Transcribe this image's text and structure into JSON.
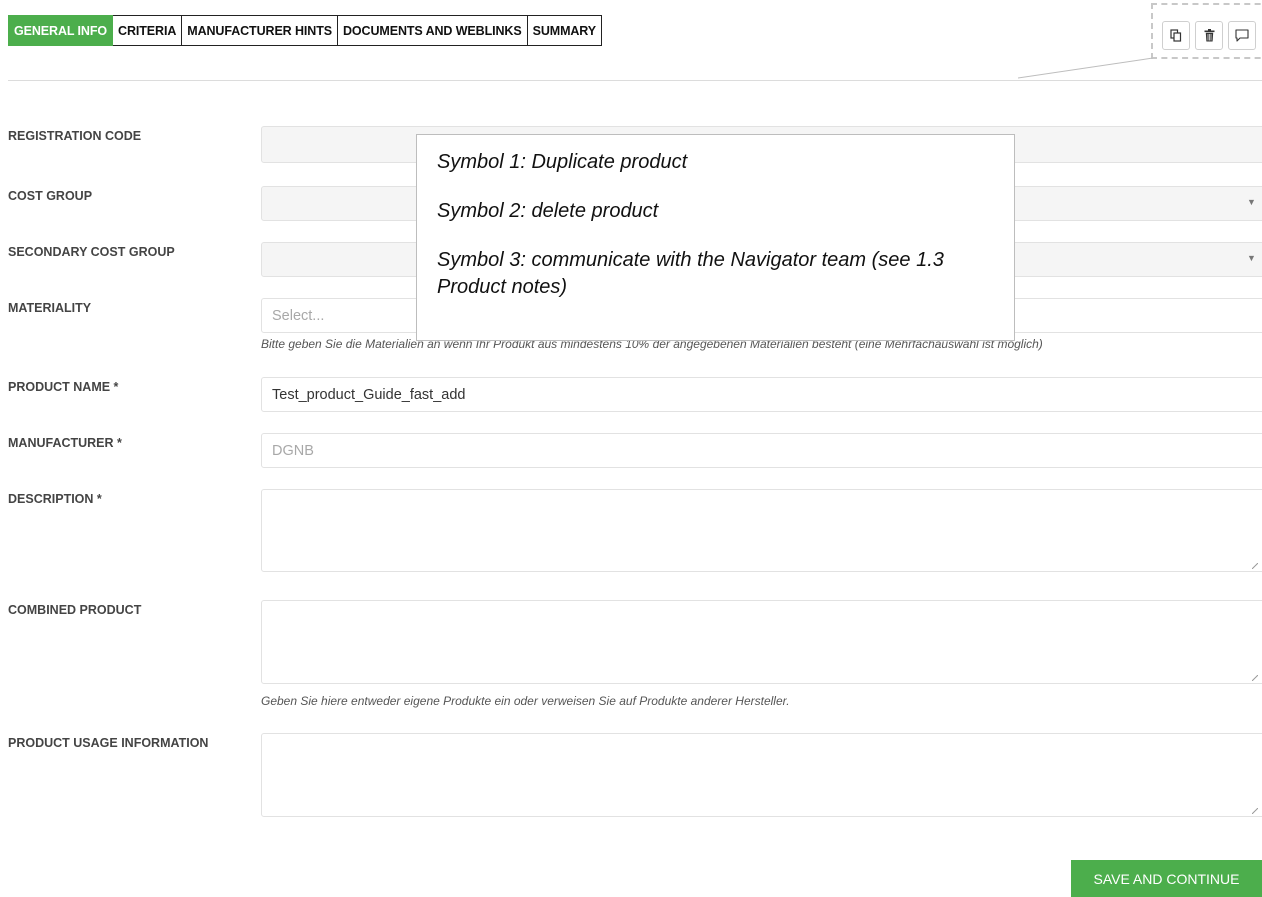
{
  "tabs": [
    {
      "label": "GENERAL INFO",
      "active": true
    },
    {
      "label": "CRITERIA",
      "active": false
    },
    {
      "label": "MANUFACTURER HINTS",
      "active": false
    },
    {
      "label": "DOCUMENTS AND WEBLINKS",
      "active": false
    },
    {
      "label": "SUMMARY",
      "active": false
    }
  ],
  "toolbar": {
    "icons": [
      "duplicate-icon",
      "trash-icon",
      "comment-icon"
    ]
  },
  "form": {
    "registration_code": {
      "label": "REGISTRATION CODE",
      "value": ""
    },
    "cost_group": {
      "label": "COST GROUP",
      "value": ""
    },
    "secondary_cost_group": {
      "label": "SECONDARY COST GROUP",
      "value": ""
    },
    "materiality": {
      "label": "MATERIALITY",
      "placeholder": "Select...",
      "help": "Bitte geben Sie die Materialien an wenn Ihr Produkt aus mindestens 10% der angegebenen Materialien besteht (eine Mehrfachauswahl ist möglich)"
    },
    "product_name": {
      "label": "PRODUCT NAME *",
      "value": "Test_product_Guide_fast_add"
    },
    "manufacturer": {
      "label": "MANUFACTURER *",
      "value": "DGNB"
    },
    "description": {
      "label": "DESCRIPTION *",
      "value": ""
    },
    "combined_product": {
      "label": "COMBINED PRODUCT",
      "value": "",
      "help": "Geben Sie hiere entweder eigene Produkte ein oder verweisen Sie auf Produkte anderer Hersteller."
    },
    "usage_information": {
      "label": "PRODUCT USAGE INFORMATION",
      "value": ""
    }
  },
  "annotation": {
    "line1": "Symbol 1: Duplicate product",
    "line2": "Symbol 2: delete product",
    "line3": "Symbol 3: communicate with the Navigator team (see 1.3 Product notes)"
  },
  "actions": {
    "save_label": "SAVE AND CONTINUE"
  },
  "colors": {
    "accent": "#4cae4c"
  }
}
